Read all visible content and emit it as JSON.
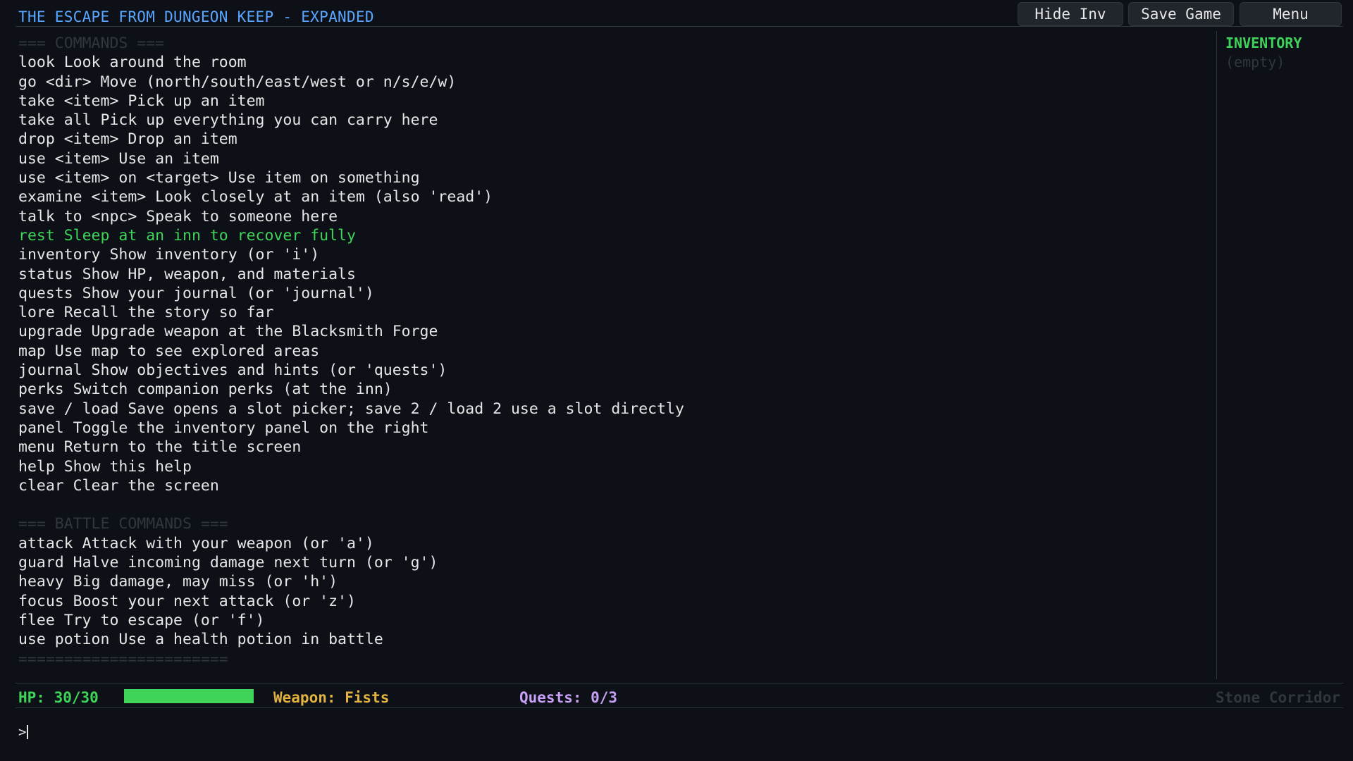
{
  "header": {
    "title": "THE ESCAPE FROM DUNGEON KEEP - EXPANDED",
    "buttons": {
      "hide_inv": "Hide Inv",
      "save_game": "Save Game",
      "menu": "Menu"
    }
  },
  "console": {
    "lines": [
      {
        "type": "header",
        "text": "=== COMMANDS ==="
      },
      {
        "type": "normal",
        "text": "look Look around the room"
      },
      {
        "type": "normal",
        "text": "go <dir> Move (north/south/east/west or n/s/e/w)"
      },
      {
        "type": "normal",
        "text": "take <item> Pick up an item"
      },
      {
        "type": "normal",
        "text": "take all Pick up everything you can carry here"
      },
      {
        "type": "normal",
        "text": "drop <item> Drop an item"
      },
      {
        "type": "normal",
        "text": "use <item> Use an item"
      },
      {
        "type": "normal",
        "text": "use <item> on <target> Use item on something"
      },
      {
        "type": "normal",
        "text": "examine <item> Look closely at an item (also 'read')"
      },
      {
        "type": "normal",
        "text": "talk to <npc> Speak to someone here"
      },
      {
        "type": "highlight",
        "text": "rest Sleep at an inn to recover fully"
      },
      {
        "type": "normal",
        "text": "inventory Show inventory (or 'i')"
      },
      {
        "type": "normal",
        "text": "status Show HP, weapon, and materials"
      },
      {
        "type": "normal",
        "text": "quests Show your journal (or 'journal')"
      },
      {
        "type": "normal",
        "text": "lore Recall the story so far"
      },
      {
        "type": "normal",
        "text": "upgrade Upgrade weapon at the Blacksmith Forge"
      },
      {
        "type": "normal",
        "text": "map Use map to see explored areas"
      },
      {
        "type": "normal",
        "text": "journal Show objectives and hints (or 'quests')"
      },
      {
        "type": "normal",
        "text": "perks Switch companion perks (at the inn)"
      },
      {
        "type": "normal",
        "text": "save / load Save opens a slot picker; save 2 / load 2 use a slot directly"
      },
      {
        "type": "normal",
        "text": "panel Toggle the inventory panel on the right"
      },
      {
        "type": "normal",
        "text": "menu Return to the title screen"
      },
      {
        "type": "normal",
        "text": "help Show this help"
      },
      {
        "type": "normal",
        "text": "clear Clear the screen"
      },
      {
        "type": "blank",
        "text": ""
      },
      {
        "type": "header",
        "text": "=== BATTLE COMMANDS ==="
      },
      {
        "type": "normal",
        "text": "attack Attack with your weapon (or 'a')"
      },
      {
        "type": "normal",
        "text": "guard Halve incoming damage next turn (or 'g')"
      },
      {
        "type": "normal",
        "text": "heavy Big damage, may miss (or 'h')"
      },
      {
        "type": "normal",
        "text": "focus Boost your next attack (or 'z')"
      },
      {
        "type": "normal",
        "text": "flee Try to escape (or 'f')"
      },
      {
        "type": "normal",
        "text": "use potion Use a health potion in battle"
      },
      {
        "type": "header",
        "text": "======================="
      }
    ]
  },
  "inventory": {
    "title": "INVENTORY",
    "empty_text": "(empty)"
  },
  "status": {
    "hp_label": "HP: 30/30",
    "hp_current": 30,
    "hp_max": 30,
    "weapon_label": "Weapon: Fists",
    "quests_label": "Quests: 0/3",
    "location": "Stone Corridor"
  },
  "input": {
    "prompt": ">",
    "value": ""
  },
  "colors": {
    "background": "#0d1117",
    "title": "#58a6ff",
    "text": "#e6e6e6",
    "dim": "#30363d",
    "highlight_green": "#3fd35a",
    "weapon_gold": "#e3b341",
    "quests_purple": "#c9a0f7"
  }
}
